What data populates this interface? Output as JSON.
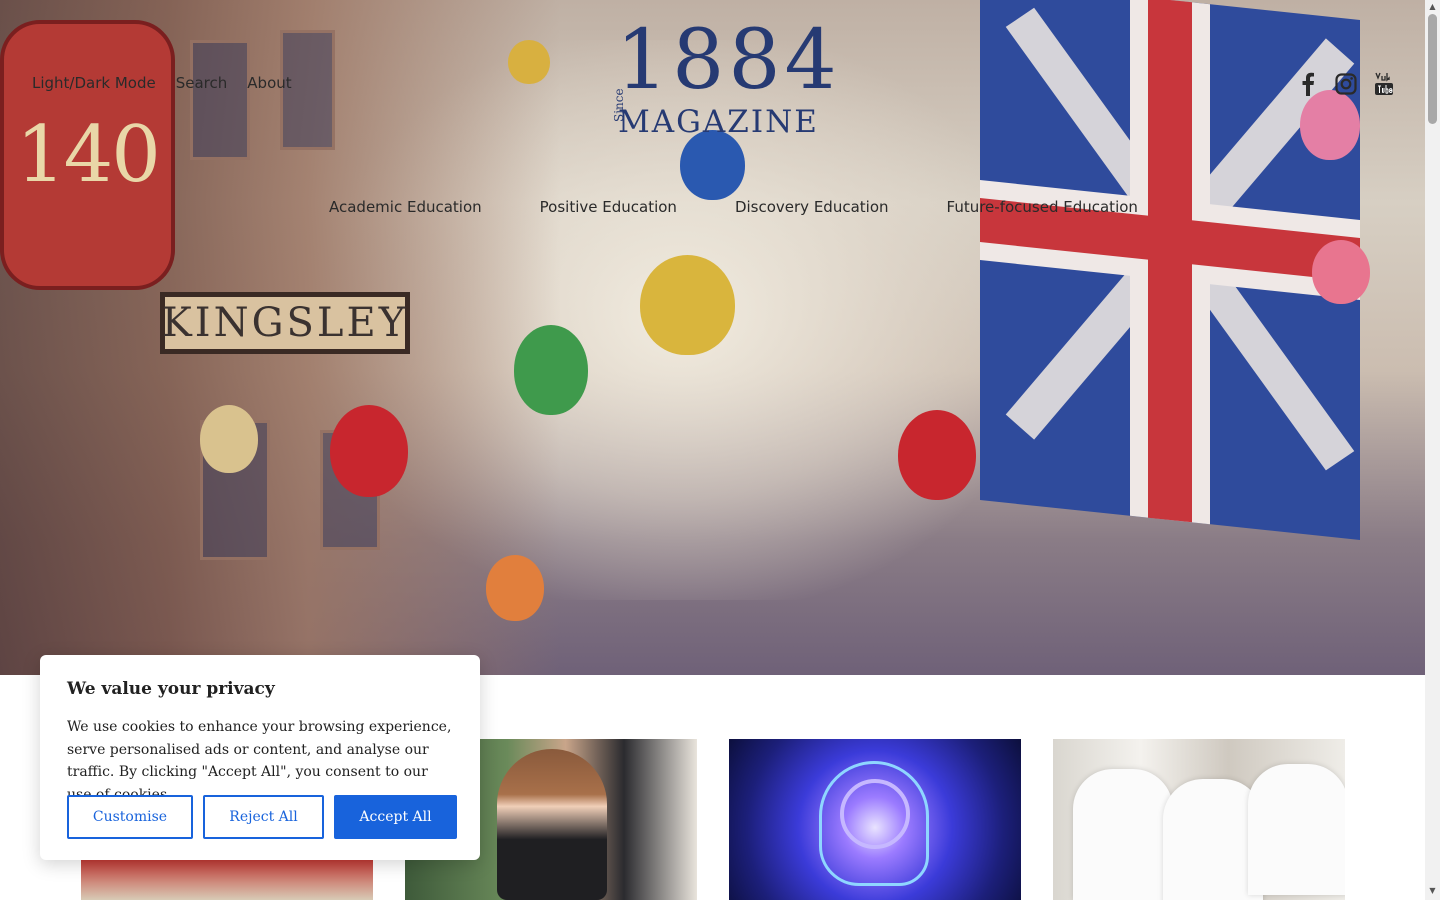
{
  "header": {
    "nav_left": [
      "Light/Dark Mode",
      "Search",
      "About"
    ],
    "logo": {
      "since": "Since",
      "year": "1884",
      "magazine": "MAGAZINE"
    },
    "social_icons": [
      "facebook-icon",
      "instagram-icon",
      "youtube-icon"
    ],
    "nav_main": [
      "Academic Education",
      "Positive Education",
      "Discovery Education",
      "Future-focused Education"
    ]
  },
  "hero": {
    "sign_number": "140",
    "sign_street": "KINGSLEY"
  },
  "cookie_banner": {
    "title": "We value your privacy",
    "body": "We use cookies to enhance your browsing experience, serve personalised ads or content, and analyse our traffic. By clicking \"Accept All\", you consent to our use of cookies.",
    "customise_label": "Customise",
    "reject_label": "Reject All",
    "accept_label": "Accept All",
    "accent_color": "#1863dc"
  },
  "colors": {
    "logo": "#263a73",
    "nav_text": "#2a2a2a"
  }
}
